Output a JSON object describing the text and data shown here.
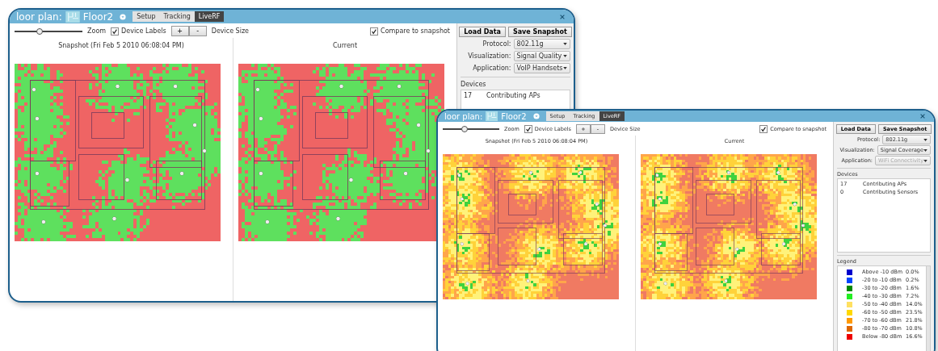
{
  "windows": [
    {
      "title_prefix": "loor plan:",
      "floor": "Floor2",
      "tabs": [
        {
          "label": "Setup",
          "selected": false
        },
        {
          "label": "Tracking",
          "selected": false
        },
        {
          "label": "LiveRF",
          "selected": true
        }
      ],
      "toolbar": {
        "zoom_label": "Zoom",
        "zoom": {
          "level": 0.37
        },
        "device_labels": {
          "label": "Device Labels",
          "checked": true
        },
        "size_buttons": [
          "+",
          "-"
        ],
        "device_size_label": "Device Size",
        "compare": {
          "label": "Compare to snapshot",
          "checked": true
        }
      },
      "panels": [
        {
          "title": "Snapshot (Fri Feb 5 2010 06:08:04 PM)"
        },
        {
          "title": "Current"
        }
      ],
      "sidebar": {
        "buttons": [
          "Load Data",
          "Save Snapshot"
        ],
        "fields": [
          {
            "label": "Protocol:",
            "value": "802.11g",
            "disabled": false
          },
          {
            "label": "Visualization:",
            "value": "Signal Quality",
            "disabled": false
          },
          {
            "label": "Application:",
            "value": "VoIP Handsets",
            "disabled": false
          }
        ],
        "devices_label": "Devices",
        "devices": [
          {
            "count": "17",
            "name": "Contributing APs"
          }
        ]
      }
    },
    {
      "title_prefix": "loor plan:",
      "floor": "Floor2",
      "tabs": [
        {
          "label": "Setup",
          "selected": false
        },
        {
          "label": "Tracking",
          "selected": false
        },
        {
          "label": "LiveRF",
          "selected": true
        }
      ],
      "toolbar": {
        "zoom_label": "Zoom",
        "zoom": {
          "level": 0.38
        },
        "device_labels": {
          "label": "Device Labels",
          "checked": true
        },
        "size_buttons": [
          "+",
          "-"
        ],
        "device_size_label": "Device Size",
        "compare": {
          "label": "Compare to snapshot",
          "checked": true
        }
      },
      "panels": [
        {
          "title": "Snapshot (Fri Feb 5 2010 06:08:04 PM)"
        },
        {
          "title": "Current"
        }
      ],
      "sidebar": {
        "buttons": [
          "Load Data",
          "Save Snapshot"
        ],
        "fields": [
          {
            "label": "Protocol:",
            "value": "802.11g",
            "disabled": false
          },
          {
            "label": "Visualization:",
            "value": "Signal Coverage",
            "disabled": false
          },
          {
            "label": "Application:",
            "value": "WiFi Connectivity",
            "disabled": true
          }
        ],
        "devices_label": "Devices",
        "devices": [
          {
            "count": "17",
            "name": "Contributing APs"
          },
          {
            "count": "0",
            "name": "Contributing Sensors"
          }
        ],
        "legend": {
          "label": "Legend",
          "rows": [
            {
              "color": "#0000cc",
              "range": "Above -10 dBm",
              "share": "0.0%"
            },
            {
              "color": "#0044ff",
              "range": "-20 to -10 dBm",
              "share": "0.2%"
            },
            {
              "color": "#008800",
              "range": "-30 to -20 dBm",
              "share": "1.6%"
            },
            {
              "color": "#22ee22",
              "range": "-40 to -30 dBm",
              "share": "7.2%"
            },
            {
              "color": "#ffe060",
              "range": "-50 to -40 dBm",
              "share": "14.0%"
            },
            {
              "color": "#ffd800",
              "range": "-60 to -50 dBm",
              "share": "23.5%"
            },
            {
              "color": "#ff9900",
              "range": "-70 to -60 dBm",
              "share": "21.8%"
            },
            {
              "color": "#dd6600",
              "range": "-80 to -70 dBm",
              "share": "10.8%"
            },
            {
              "color": "#ee0000",
              "range": "Below -80 dBm",
              "share": "16.6%"
            }
          ]
        }
      }
    }
  ]
}
